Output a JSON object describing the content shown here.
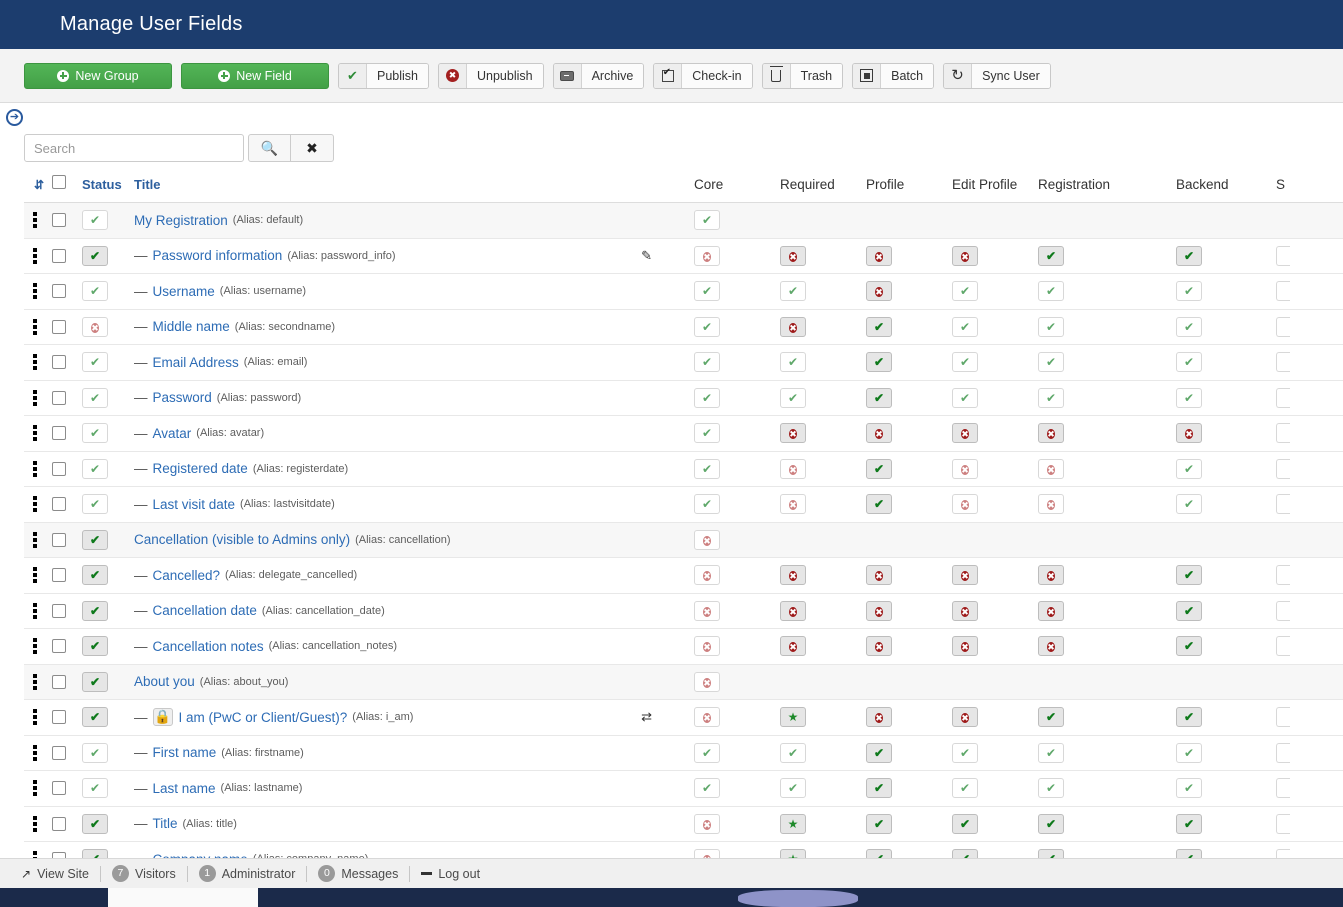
{
  "header": {
    "title": "Manage User Fields"
  },
  "toolbar": {
    "new_group": "New Group",
    "new_field": "New Field",
    "publish": "Publish",
    "unpublish": "Unpublish",
    "archive": "Archive",
    "checkin": "Check-in",
    "trash": "Trash",
    "batch": "Batch",
    "sync_user": "Sync User"
  },
  "sidebar_toggle": {
    "icon": "arrow-right-circle-icon"
  },
  "search": {
    "placeholder": "Search",
    "value": "",
    "search_icon": "search-icon",
    "clear_icon": "clear-icon"
  },
  "table": {
    "headers": {
      "ordering": "",
      "checkall": "",
      "status": "Status",
      "title": "Title",
      "core": "Core",
      "required": "Required",
      "profile": "Profile",
      "edit_profile": "Edit Profile",
      "registration": "Registration",
      "backend": "Backend",
      "site": "S"
    },
    "rows": [
      {
        "type": "group",
        "status": "check",
        "title": "My Registration",
        "alias": "(Alias: default)",
        "core": "check",
        "required": "",
        "profile": "",
        "edit_profile": "",
        "registration": "",
        "backend": "",
        "site": "",
        "rowicon": ""
      },
      {
        "type": "field",
        "status": "check-active",
        "title": "Password information",
        "alias": "(Alias: password_info)",
        "core": "x",
        "required": "x-active",
        "profile": "x-active",
        "edit_profile": "x-active",
        "registration": "check-active",
        "backend": "check-active",
        "site": "partial",
        "rowicon": "pencil-icon"
      },
      {
        "type": "field",
        "status": "check",
        "title": "Username",
        "alias": "(Alias: username)",
        "core": "check",
        "required": "check",
        "profile": "x-active",
        "edit_profile": "check",
        "registration": "check",
        "backend": "check",
        "site": "partial",
        "rowicon": ""
      },
      {
        "type": "field",
        "status": "x",
        "title": "Middle name",
        "alias": "(Alias: secondname)",
        "core": "check",
        "required": "x-active",
        "profile": "check-active",
        "edit_profile": "check",
        "registration": "check",
        "backend": "check",
        "site": "partial",
        "rowicon": ""
      },
      {
        "type": "field",
        "status": "check",
        "title": "Email Address",
        "alias": "(Alias: email)",
        "core": "check",
        "required": "check",
        "profile": "check-active",
        "edit_profile": "check",
        "registration": "check",
        "backend": "check",
        "site": "partial",
        "rowicon": ""
      },
      {
        "type": "field",
        "status": "check",
        "title": "Password",
        "alias": "(Alias: password)",
        "core": "check",
        "required": "check",
        "profile": "check-active",
        "edit_profile": "check",
        "registration": "check",
        "backend": "check",
        "site": "partial",
        "rowicon": ""
      },
      {
        "type": "field",
        "status": "check",
        "title": "Avatar",
        "alias": "(Alias: avatar)",
        "core": "check",
        "required": "x-active",
        "profile": "x-active",
        "edit_profile": "x-active",
        "registration": "x-active",
        "backend": "x-active",
        "site": "partial",
        "rowicon": ""
      },
      {
        "type": "field",
        "status": "check",
        "title": "Registered date",
        "alias": "(Alias: registerdate)",
        "core": "check",
        "required": "x",
        "profile": "check-active",
        "edit_profile": "x",
        "registration": "x",
        "backend": "check",
        "site": "partial",
        "rowicon": ""
      },
      {
        "type": "field",
        "status": "check",
        "title": "Last visit date",
        "alias": "(Alias: lastvisitdate)",
        "core": "check",
        "required": "x",
        "profile": "check-active",
        "edit_profile": "x",
        "registration": "x",
        "backend": "check",
        "site": "partial",
        "rowicon": ""
      },
      {
        "type": "group",
        "status": "check-active",
        "title": "Cancellation (visible to Admins only)",
        "alias": "(Alias: cancellation)",
        "core": "x",
        "required": "",
        "profile": "",
        "edit_profile": "",
        "registration": "",
        "backend": "",
        "site": "",
        "rowicon": ""
      },
      {
        "type": "field",
        "status": "check-active",
        "title": "Cancelled?",
        "alias": "(Alias: delegate_cancelled)",
        "core": "x",
        "required": "x-active",
        "profile": "x-active",
        "edit_profile": "x-active",
        "registration": "x-active",
        "backend": "check-active",
        "site": "partial",
        "rowicon": ""
      },
      {
        "type": "field",
        "status": "check-active",
        "title": "Cancellation date",
        "alias": "(Alias: cancellation_date)",
        "core": "x",
        "required": "x-active",
        "profile": "x-active",
        "edit_profile": "x-active",
        "registration": "x-active",
        "backend": "check-active",
        "site": "partial",
        "rowicon": ""
      },
      {
        "type": "field",
        "status": "check-active",
        "title": "Cancellation notes",
        "alias": "(Alias: cancellation_notes)",
        "core": "x",
        "required": "x-active",
        "profile": "x-active",
        "edit_profile": "x-active",
        "registration": "x-active",
        "backend": "check-active",
        "site": "partial",
        "rowicon": ""
      },
      {
        "type": "group",
        "status": "check-active",
        "title": "About you",
        "alias": "(Alias: about_you)",
        "core": "x",
        "required": "",
        "profile": "",
        "edit_profile": "",
        "registration": "",
        "backend": "",
        "site": "",
        "rowicon": ""
      },
      {
        "type": "field",
        "status": "check-active",
        "title": "I am (PwC or Client/Guest)?",
        "alias": "(Alias: i_am)",
        "locked": true,
        "core": "x",
        "required": "star-active",
        "profile": "x-active",
        "edit_profile": "x-active",
        "registration": "check-active",
        "backend": "check-active",
        "site": "partial",
        "rowicon": "shuffle-icon"
      },
      {
        "type": "field",
        "status": "check",
        "title": "First name",
        "alias": "(Alias: firstname)",
        "core": "check",
        "required": "check",
        "profile": "check-active",
        "edit_profile": "check",
        "registration": "check",
        "backend": "check",
        "site": "partial",
        "rowicon": ""
      },
      {
        "type": "field",
        "status": "check",
        "title": "Last name",
        "alias": "(Alias: lastname)",
        "core": "check",
        "required": "check",
        "profile": "check-active",
        "edit_profile": "check",
        "registration": "check",
        "backend": "check",
        "site": "partial",
        "rowicon": ""
      },
      {
        "type": "field",
        "status": "check-active",
        "title": "Title",
        "alias": "(Alias: title)",
        "core": "x",
        "required": "star-active",
        "profile": "check-active",
        "edit_profile": "check-active",
        "registration": "check-active",
        "backend": "check-active",
        "site": "partial",
        "rowicon": ""
      },
      {
        "type": "field",
        "status": "check-active",
        "title": "Company name",
        "alias": "(Alias: company_name)",
        "core": "x",
        "required": "star-active",
        "profile": "check-active",
        "edit_profile": "check-active",
        "registration": "check-active",
        "backend": "check-active",
        "site": "partial",
        "rowicon": ""
      }
    ]
  },
  "footer": {
    "view_site": "View Site",
    "visitors_count": "7",
    "visitors": "Visitors",
    "admin_count": "1",
    "administrator": "Administrator",
    "messages_count": "0",
    "messages": "Messages",
    "logout": "Log out"
  },
  "colors": {
    "header_bg": "#1c3d6e",
    "primary_green": "#4caf50",
    "link_blue": "#2d6cb5",
    "status_ok": "#1f8a2b",
    "status_error": "#9e1b1b"
  }
}
